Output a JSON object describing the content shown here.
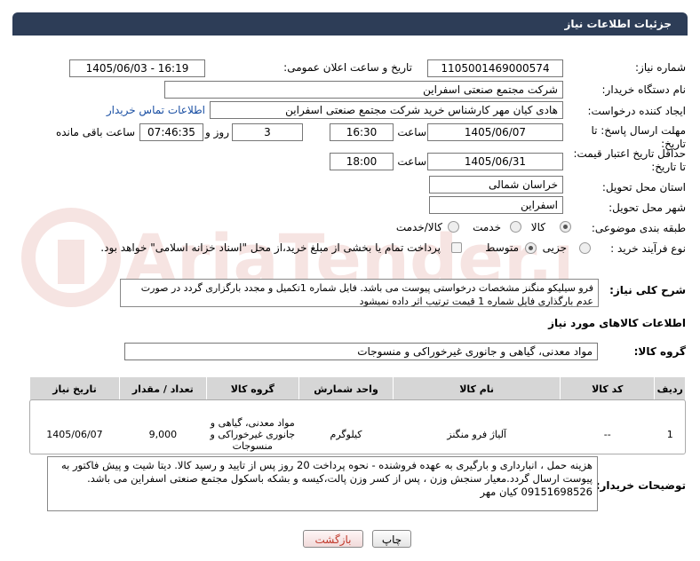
{
  "header": {
    "title": "جزئیات اطلاعات نیاز"
  },
  "form": {
    "need_number_label": "شماره نیاز:",
    "need_number": "1105001469000574",
    "announce_label": "تاریخ و ساعت اعلان عمومی:",
    "announce_value": "1405/06/03 - 16:19",
    "buyer_org_label": "نام دستگاه خریدار:",
    "buyer_org": "شرکت مجتمع صنعتی اسفراین",
    "creator_label": "ایجاد کننده درخواست:",
    "creator": "هادی کیان مهر کارشناس خرید شرکت مجتمع صنعتی اسفراین",
    "contact_link": "اطلاعات تماس خریدار",
    "send_deadline_label": "مهلت ارسال پاسخ: تا تاریخ:",
    "send_date": "1405/06/07",
    "time_label": "ساعت",
    "send_time": "16:30",
    "days_value": "3",
    "days_label": "روز و",
    "remaining_time": "07:46:35",
    "remaining_label": "ساعت باقی مانده",
    "price_validity_label": "حداقل تاریخ اعتبار قیمت: تا تاریخ:",
    "price_date": "1405/06/31",
    "price_time": "18:00",
    "province_label": "استان محل تحویل:",
    "province": "خراسان شمالی",
    "city_label": "شهر محل تحویل:",
    "city": "اسفراین",
    "category_label": "طبقه بندی موضوعی:",
    "category_options": [
      "کالا",
      "خدمت",
      "کالا/خدمت"
    ],
    "category_selected": "کالا",
    "process_label": "نوع فرآیند خرید :",
    "process_options": [
      "جزیی",
      "متوسط"
    ],
    "process_selected": "متوسط",
    "payment_note": "پرداخت تمام یا بخشی از مبلغ خرید،از محل \"اسناد خزانه اسلامی\" خواهد بود."
  },
  "description": {
    "label": "شرح کلی نیاز:",
    "text": "فرو سیلیکو منگنز مشخصات درخواستی پیوست می باشد. فایل شماره 1تکمیل و مجدد بارگزاری گردد در صورت عدم بارگذاری فایل شماره 1 قیمت ترتیب اثر داده  نمیشود"
  },
  "goods": {
    "section_title": "اطلاعات کالاهای مورد نیاز",
    "group_label": "گروه کالا:",
    "group_value": "مواد معدنی، گیاهی و جانوری غیرخوراکی و منسوجات",
    "columns": [
      "ردیف",
      "کد کالا",
      "نام کالا",
      "واحد شمارش",
      "گروه کالا",
      "تعداد / مقدار",
      "تاریخ نیاز"
    ],
    "rows": [
      {
        "row": "1",
        "code": "--",
        "name": "آلیاژ فرو منگنز",
        "unit": "کیلوگرم",
        "group": "مواد معدنی، گیاهی و جانوری غیرخوراکی و منسوجات",
        "qty": "9,000",
        "date": "1405/06/07"
      }
    ]
  },
  "buyer_notes": {
    "label": "توضیحات خریدار:",
    "text": "هزینه حمل ، انبارداری و بارگیری به عهده فروشنده - نحوه پرداخت 20 روز پس از تایید و رسید کالا. دیتا شیت و پیش فاکتور به پیوست ارسال گردد.معیار سنجش وزن ، پس از کسر وزن پالت،کیسه و بشکه باسکول مجتمع صنعتی اسفراین می باشد. 09151698526 کیان مهر"
  },
  "buttons": {
    "print": "چاپ",
    "back": "بازگشت"
  },
  "watermark": {
    "text": "AriaTender.net"
  },
  "colors": {
    "header_bg": "#2d3d57",
    "link": "#1a4fa3",
    "back_text": "#c0392b"
  }
}
